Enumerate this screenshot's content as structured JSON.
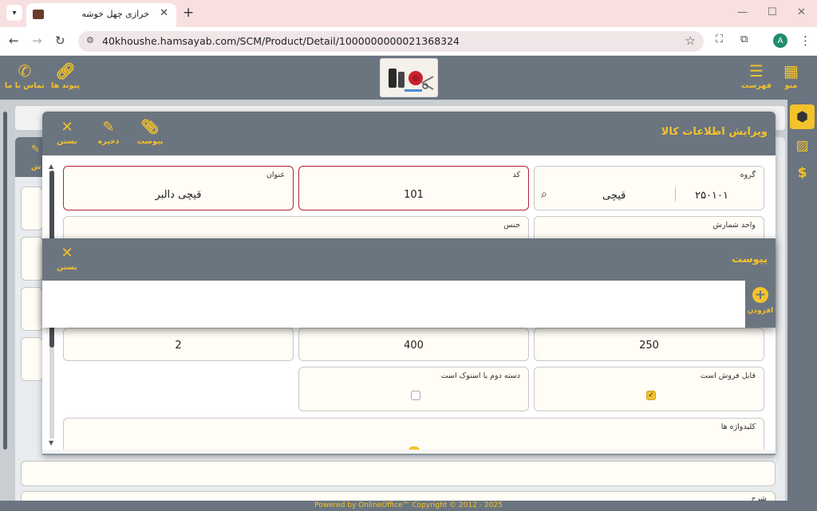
{
  "browser": {
    "tab_title": "خرازی چهل خوشه",
    "url": "40khoushe.hamsayab.com/SCM/Product/Detail/1000000000021368324",
    "profile_initial": "A"
  },
  "header": {
    "menu_label": "منو",
    "list_label": "فهرست",
    "links_label": "پیوند ها",
    "contact_label": "تماس با ما"
  },
  "edit_modal": {
    "title": "ویرایش اطلاعات کالا",
    "attach_label": "پیوست",
    "save_label": "ذخیره",
    "close_label": "بستن",
    "fields": {
      "group_label": "گروه",
      "group_code": "۲۵۰۱۰۱",
      "group_name": "قیچی",
      "code_label": "کد",
      "code_value": "101",
      "title_label": "عنوان",
      "title_value": "قیچی دالبر",
      "unit_label": "واحد شمارش",
      "material_label": "جنس",
      "num1": "250",
      "num2": "400",
      "num3": "2",
      "sellable_label": "قابل فروش است",
      "secondhand_label": "دسته دوم یا استوک است",
      "keywords_label": "کلیدواژه ها"
    },
    "sellable_checked": true,
    "secondhand_checked": false
  },
  "attach_modal": {
    "title": "پیوست",
    "close_label": "بستن",
    "add_label": "افزودن"
  },
  "background": {
    "partial_label": "ش",
    "bottom_partial": "شرح"
  },
  "footer": {
    "text": "Powered by OnlineOffice™ Copyright © 2012 - 2025"
  },
  "colors": {
    "accent": "#f4c22b",
    "header_bg": "#6b7580",
    "required_border": "#b0243a"
  }
}
